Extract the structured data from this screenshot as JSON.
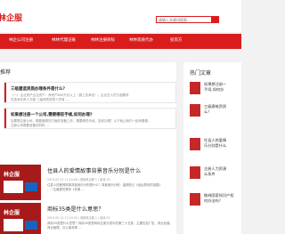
{
  "header": {
    "logo": "林企服",
    "search_placeholder": "请输入关键词搜索..."
  },
  "nav": {
    "items": [
      "林企公司注册",
      "林林代理记账",
      "林林注册商标",
      "林林资质代办",
      "投资方"
    ]
  },
  "main": {
    "panel_title": "推荐"
  },
  "featured": [
    {
      "title": "三级建造资质办理条件是什么？",
      "desc": "（一）企业资产企业资产：净资产800万元以上（施工总承包）；企业在人员方面要求",
      "desc2": "在技术负责人方面 三级资质资质人员有 ..."
    },
    {
      "title": "如果想注册一个公司,需要哪些手续,如何办理?",
      "desc": "如果想注册公司，需要做哪些方面的准备工作，需要哪些手续，如何办理？以下就让我们一起来看看，",
      "desc2": "注册公司需要准备的材料 ..."
    }
  ],
  "posts": [
    {
      "thumb_label": "林企服",
      "title": "住县人的爱情故事背景音乐分别是什么",
      "meta": "2023-05-12 11:24:46 | 营销林企服 1 | 阅读 26",
      "desc": "住县人的爱情故事背景音乐分别是什么？背景音乐分别：蓝颜知己《恰恰是你的话题》",
      "desc2": "、一生最爱的是你《完美 ..."
    },
    {
      "thumb_label": "林企服",
      "title": "商标35类是什么意思？",
      "meta": "2023-05-12 11:24:30 | 营销林企服 1 | 阅读 35",
      "desc": "商标35类是什么意思？商标35类是商标注册分类中的第三十五类，主要包括广告、商业经营、",
      "desc2": "商业管理、办公事务等 ..."
    }
  ],
  "sidebar": {
    "title": "热门文章",
    "items": [
      {
        "line1": "如果想注册一",
        "line2": "手续,如何办"
      },
      {
        "line1": "三级建筑资质",
        "line2": "么？"
      },
      {
        "line1": "住县人的爱情",
        "line2": "乐分别是什么"
      },
      {
        "line1": "注册人力资源",
        "line2": "么条件"
      },
      {
        "line1": "榆林国家知识产权",
        "line2": "何办法吗？"
      }
    ]
  }
}
